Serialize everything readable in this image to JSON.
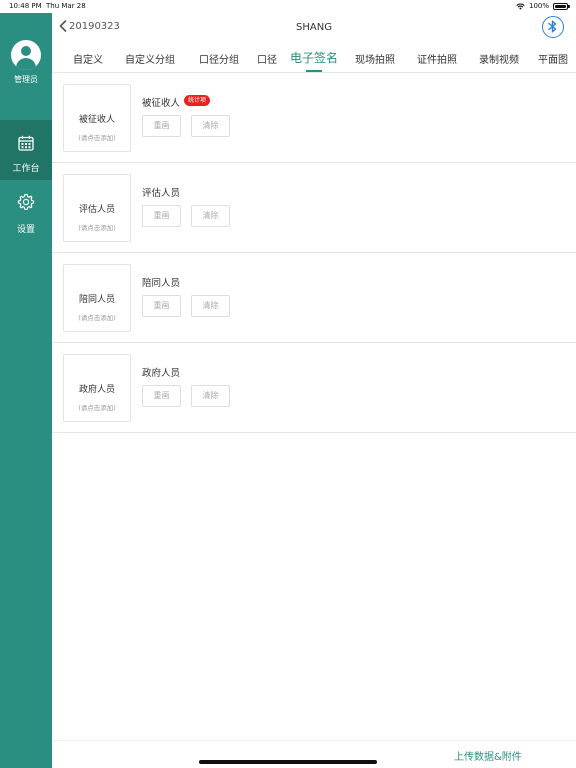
{
  "status_bar": {
    "time": "10:48 PM",
    "date": "Thu Mar 28",
    "battery": "100%"
  },
  "sidebar": {
    "user_label": "管理员",
    "items": [
      {
        "label": "工作台",
        "icon": "calendar-icon",
        "active": true
      },
      {
        "label": "设置",
        "icon": "gear-icon",
        "active": false
      }
    ]
  },
  "header": {
    "back_label": "20190323",
    "title": "SHANG",
    "bluetooth_icon": "bluetooth-icon"
  },
  "tabs": [
    {
      "label": "自定义"
    },
    {
      "label": "自定义分组"
    },
    {
      "label": "口径分组"
    },
    {
      "label": "口径"
    },
    {
      "label": "电子签名",
      "active": true
    },
    {
      "label": "现场拍照"
    },
    {
      "label": "证件拍照"
    },
    {
      "label": "录制视频"
    },
    {
      "label": "平面图"
    }
  ],
  "signatures": [
    {
      "box_title": "被征收人",
      "hint": "(请点击添加)",
      "role": "被征收人",
      "badge": "统计项",
      "redraw": "重画",
      "clear": "清除"
    },
    {
      "box_title": "评估人员",
      "hint": "(请点击添加)",
      "role": "评估人员",
      "redraw": "重画",
      "clear": "清除"
    },
    {
      "box_title": "陪同人员",
      "hint": "(请点击添加)",
      "role": "陪同人员",
      "redraw": "重画",
      "clear": "清除"
    },
    {
      "box_title": "政府人员",
      "hint": "(请点击添加)",
      "role": "政府人员",
      "redraw": "重画",
      "clear": "清除"
    }
  ],
  "footer": {
    "upload_label": "上传数据&附件"
  },
  "colors": {
    "accent": "#2a8f80",
    "sidebar_active": "#217566",
    "badge": "#e8231e",
    "bluetooth": "#2d7fd9"
  }
}
